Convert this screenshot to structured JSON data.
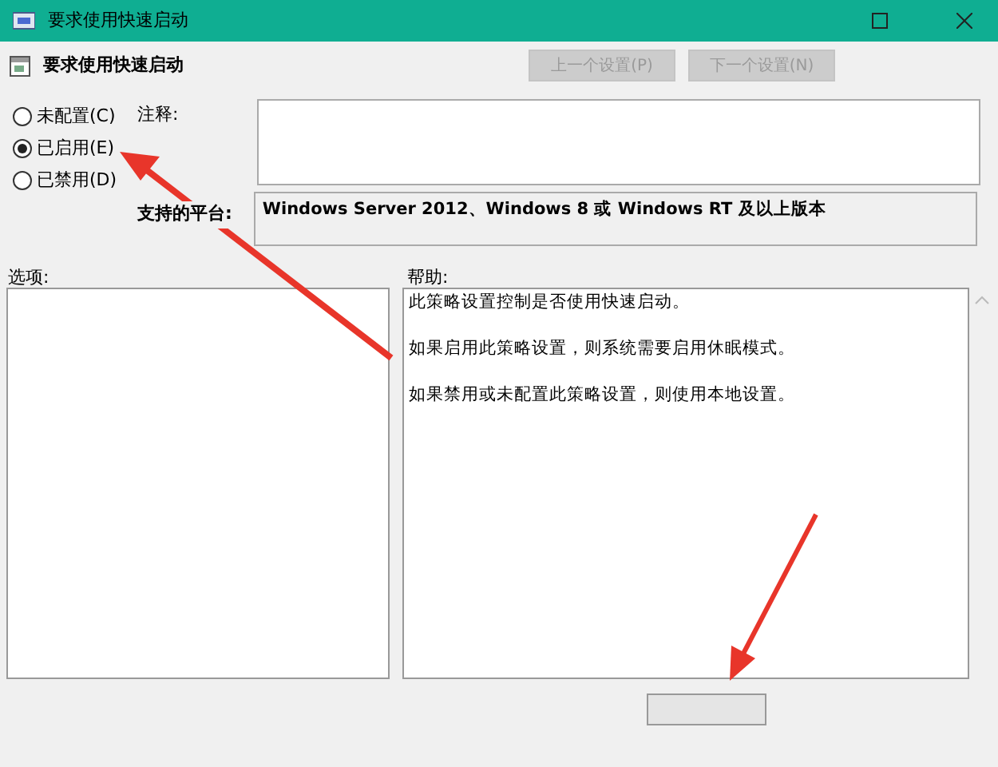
{
  "window": {
    "title": "要求使用快速启动"
  },
  "header": {
    "title": "要求使用快速启动",
    "buttons": [
      {
        "label": "上一个设置(P)",
        "disabled": true
      },
      {
        "label": "下一个设置(N)",
        "disabled": true
      }
    ]
  },
  "options": [
    {
      "label": "未配置(C)",
      "selected": false
    },
    {
      "label": "已启用(E)",
      "selected": true
    },
    {
      "label": "已禁用(D)",
      "selected": false
    }
  ],
  "comment": {
    "label": "注释:"
  },
  "platform": {
    "label": "支持的平台:",
    "value": "Windows Server 2012、Windows 8 或 Windows RT 及以上版本"
  },
  "options_panel": {
    "label": "选项:"
  },
  "help": {
    "label": "帮助:",
    "paragraphs": [
      "此策略设置控制是否使用快速启动。",
      "如果启用此策略设置，则系统需要启用休眠模式。",
      "如果禁用或未配置此策略设置，则使用本地设置。"
    ]
  }
}
